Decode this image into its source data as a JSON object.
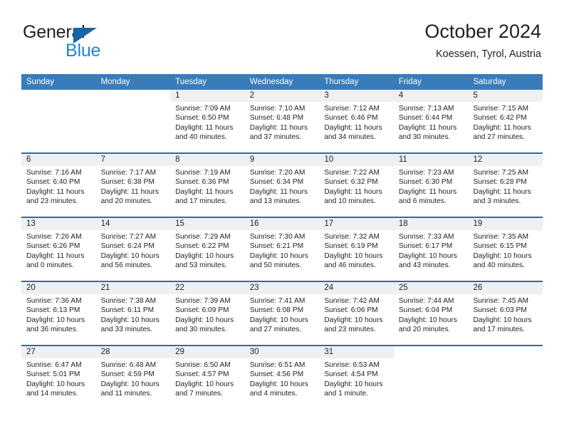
{
  "logo": {
    "word1": "General",
    "word2": "Blue",
    "triangle_color": "#1565a8",
    "blue_color": "#1e87d6"
  },
  "header": {
    "title": "October 2024",
    "location": "Koessen, Tyrol, Austria"
  },
  "theme": {
    "header_band": "#3a7cb9",
    "week_separator": "#2b6da8",
    "daynum_band": "#f0f0f0",
    "text": "#231f20"
  },
  "weekdays": [
    "Sunday",
    "Monday",
    "Tuesday",
    "Wednesday",
    "Thursday",
    "Friday",
    "Saturday"
  ],
  "weeks": [
    [
      {
        "day": "",
        "sunrise": "",
        "sunset": "",
        "daylight1": "",
        "daylight2": ""
      },
      {
        "day": "",
        "sunrise": "",
        "sunset": "",
        "daylight1": "",
        "daylight2": ""
      },
      {
        "day": "1",
        "sunrise": "Sunrise: 7:09 AM",
        "sunset": "Sunset: 6:50 PM",
        "daylight1": "Daylight: 11 hours",
        "daylight2": "and 40 minutes."
      },
      {
        "day": "2",
        "sunrise": "Sunrise: 7:10 AM",
        "sunset": "Sunset: 6:48 PM",
        "daylight1": "Daylight: 11 hours",
        "daylight2": "and 37 minutes."
      },
      {
        "day": "3",
        "sunrise": "Sunrise: 7:12 AM",
        "sunset": "Sunset: 6:46 PM",
        "daylight1": "Daylight: 11 hours",
        "daylight2": "and 34 minutes."
      },
      {
        "day": "4",
        "sunrise": "Sunrise: 7:13 AM",
        "sunset": "Sunset: 6:44 PM",
        "daylight1": "Daylight: 11 hours",
        "daylight2": "and 30 minutes."
      },
      {
        "day": "5",
        "sunrise": "Sunrise: 7:15 AM",
        "sunset": "Sunset: 6:42 PM",
        "daylight1": "Daylight: 11 hours",
        "daylight2": "and 27 minutes."
      }
    ],
    [
      {
        "day": "6",
        "sunrise": "Sunrise: 7:16 AM",
        "sunset": "Sunset: 6:40 PM",
        "daylight1": "Daylight: 11 hours",
        "daylight2": "and 23 minutes."
      },
      {
        "day": "7",
        "sunrise": "Sunrise: 7:17 AM",
        "sunset": "Sunset: 6:38 PM",
        "daylight1": "Daylight: 11 hours",
        "daylight2": "and 20 minutes."
      },
      {
        "day": "8",
        "sunrise": "Sunrise: 7:19 AM",
        "sunset": "Sunset: 6:36 PM",
        "daylight1": "Daylight: 11 hours",
        "daylight2": "and 17 minutes."
      },
      {
        "day": "9",
        "sunrise": "Sunrise: 7:20 AM",
        "sunset": "Sunset: 6:34 PM",
        "daylight1": "Daylight: 11 hours",
        "daylight2": "and 13 minutes."
      },
      {
        "day": "10",
        "sunrise": "Sunrise: 7:22 AM",
        "sunset": "Sunset: 6:32 PM",
        "daylight1": "Daylight: 11 hours",
        "daylight2": "and 10 minutes."
      },
      {
        "day": "11",
        "sunrise": "Sunrise: 7:23 AM",
        "sunset": "Sunset: 6:30 PM",
        "daylight1": "Daylight: 11 hours",
        "daylight2": "and 6 minutes."
      },
      {
        "day": "12",
        "sunrise": "Sunrise: 7:25 AM",
        "sunset": "Sunset: 6:28 PM",
        "daylight1": "Daylight: 11 hours",
        "daylight2": "and 3 minutes."
      }
    ],
    [
      {
        "day": "13",
        "sunrise": "Sunrise: 7:26 AM",
        "sunset": "Sunset: 6:26 PM",
        "daylight1": "Daylight: 11 hours",
        "daylight2": "and 0 minutes."
      },
      {
        "day": "14",
        "sunrise": "Sunrise: 7:27 AM",
        "sunset": "Sunset: 6:24 PM",
        "daylight1": "Daylight: 10 hours",
        "daylight2": "and 56 minutes."
      },
      {
        "day": "15",
        "sunrise": "Sunrise: 7:29 AM",
        "sunset": "Sunset: 6:22 PM",
        "daylight1": "Daylight: 10 hours",
        "daylight2": "and 53 minutes."
      },
      {
        "day": "16",
        "sunrise": "Sunrise: 7:30 AM",
        "sunset": "Sunset: 6:21 PM",
        "daylight1": "Daylight: 10 hours",
        "daylight2": "and 50 minutes."
      },
      {
        "day": "17",
        "sunrise": "Sunrise: 7:32 AM",
        "sunset": "Sunset: 6:19 PM",
        "daylight1": "Daylight: 10 hours",
        "daylight2": "and 46 minutes."
      },
      {
        "day": "18",
        "sunrise": "Sunrise: 7:33 AM",
        "sunset": "Sunset: 6:17 PM",
        "daylight1": "Daylight: 10 hours",
        "daylight2": "and 43 minutes."
      },
      {
        "day": "19",
        "sunrise": "Sunrise: 7:35 AM",
        "sunset": "Sunset: 6:15 PM",
        "daylight1": "Daylight: 10 hours",
        "daylight2": "and 40 minutes."
      }
    ],
    [
      {
        "day": "20",
        "sunrise": "Sunrise: 7:36 AM",
        "sunset": "Sunset: 6:13 PM",
        "daylight1": "Daylight: 10 hours",
        "daylight2": "and 36 minutes."
      },
      {
        "day": "21",
        "sunrise": "Sunrise: 7:38 AM",
        "sunset": "Sunset: 6:11 PM",
        "daylight1": "Daylight: 10 hours",
        "daylight2": "and 33 minutes."
      },
      {
        "day": "22",
        "sunrise": "Sunrise: 7:39 AM",
        "sunset": "Sunset: 6:09 PM",
        "daylight1": "Daylight: 10 hours",
        "daylight2": "and 30 minutes."
      },
      {
        "day": "23",
        "sunrise": "Sunrise: 7:41 AM",
        "sunset": "Sunset: 6:08 PM",
        "daylight1": "Daylight: 10 hours",
        "daylight2": "and 27 minutes."
      },
      {
        "day": "24",
        "sunrise": "Sunrise: 7:42 AM",
        "sunset": "Sunset: 6:06 PM",
        "daylight1": "Daylight: 10 hours",
        "daylight2": "and 23 minutes."
      },
      {
        "day": "25",
        "sunrise": "Sunrise: 7:44 AM",
        "sunset": "Sunset: 6:04 PM",
        "daylight1": "Daylight: 10 hours",
        "daylight2": "and 20 minutes."
      },
      {
        "day": "26",
        "sunrise": "Sunrise: 7:45 AM",
        "sunset": "Sunset: 6:03 PM",
        "daylight1": "Daylight: 10 hours",
        "daylight2": "and 17 minutes."
      }
    ],
    [
      {
        "day": "27",
        "sunrise": "Sunrise: 6:47 AM",
        "sunset": "Sunset: 5:01 PM",
        "daylight1": "Daylight: 10 hours",
        "daylight2": "and 14 minutes."
      },
      {
        "day": "28",
        "sunrise": "Sunrise: 6:48 AM",
        "sunset": "Sunset: 4:59 PM",
        "daylight1": "Daylight: 10 hours",
        "daylight2": "and 11 minutes."
      },
      {
        "day": "29",
        "sunrise": "Sunrise: 6:50 AM",
        "sunset": "Sunset: 4:57 PM",
        "daylight1": "Daylight: 10 hours",
        "daylight2": "and 7 minutes."
      },
      {
        "day": "30",
        "sunrise": "Sunrise: 6:51 AM",
        "sunset": "Sunset: 4:56 PM",
        "daylight1": "Daylight: 10 hours",
        "daylight2": "and 4 minutes."
      },
      {
        "day": "31",
        "sunrise": "Sunrise: 6:53 AM",
        "sunset": "Sunset: 4:54 PM",
        "daylight1": "Daylight: 10 hours",
        "daylight2": "and 1 minute."
      },
      {
        "day": "",
        "sunrise": "",
        "sunset": "",
        "daylight1": "",
        "daylight2": ""
      },
      {
        "day": "",
        "sunrise": "",
        "sunset": "",
        "daylight1": "",
        "daylight2": ""
      }
    ]
  ]
}
